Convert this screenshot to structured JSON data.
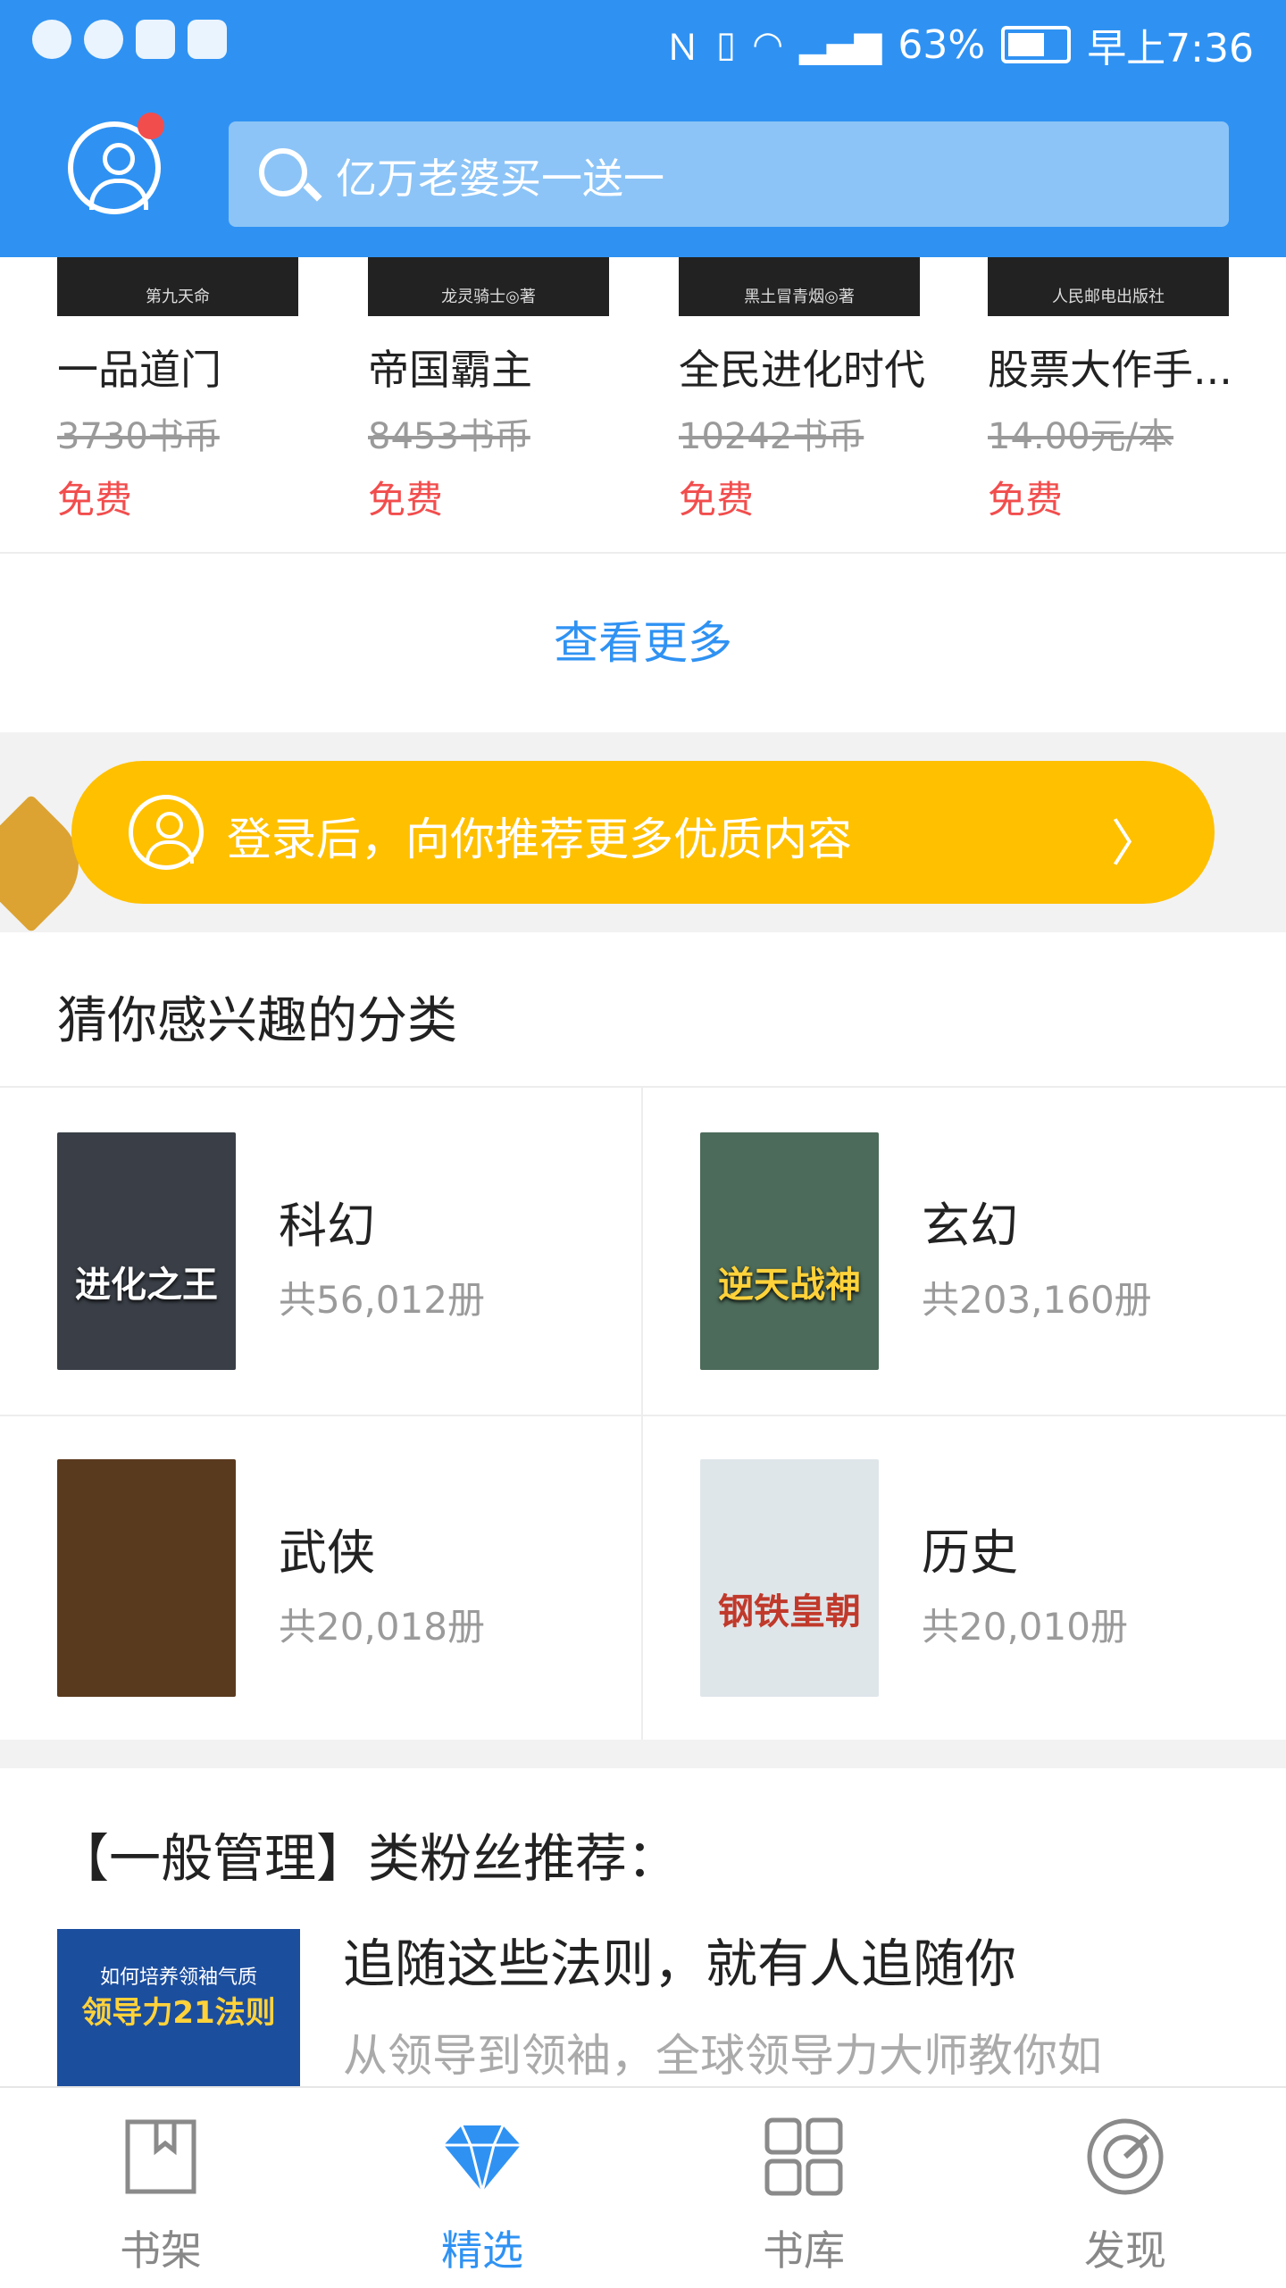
{
  "status_bar": {
    "battery": "63%",
    "time": "早上7:36"
  },
  "search": {
    "placeholder": "亿万老婆买一送一"
  },
  "top_books": [
    {
      "cover_author": "第九天命",
      "title": "一品道门",
      "original_price": "3730书币",
      "price": "免费"
    },
    {
      "cover_author": "龙灵骑士◎著",
      "title": "帝国霸主",
      "original_price": "8453书币",
      "price": "免费"
    },
    {
      "cover_author": "黑土冒青烟◎著",
      "title": "全民进化时代",
      "original_price": "10242书币",
      "price": "免费"
    },
    {
      "cover_author": "人民邮电出版社",
      "title": "股票大作手...",
      "original_price": "14.00元/本",
      "price": "免费"
    }
  ],
  "see_more": "查看更多",
  "login_banner": {
    "text": "登录后，向你推荐更多优质内容",
    "chevron": "〉"
  },
  "categories_section": {
    "title": "猜你感兴趣的分类",
    "items": [
      {
        "name": "科幻",
        "count": "共56,012册",
        "cover_text": "进化之王",
        "cover_color": "#3a3f47"
      },
      {
        "name": "玄幻",
        "count": "共203,160册",
        "cover_text": "逆天战神",
        "cover_color": "#4c6b5a"
      },
      {
        "name": "武侠",
        "count": "共20,018册",
        "cover_text": "",
        "cover_color": "#5a3a1e"
      },
      {
        "name": "历史",
        "count": "共20,010册",
        "cover_text": "钢铁皇朝",
        "cover_color": "#c0392b"
      }
    ]
  },
  "recommendation": {
    "title": "【一般管理】类粉丝推荐：",
    "book_title": "追随这些法则，就有人追随你",
    "book_desc": "从领导到领袖，全球领导力大师教你如",
    "cover_line1": "如何培养领袖气质",
    "cover_line2": "领导力21法则"
  },
  "bottom_nav": [
    {
      "label": "书架",
      "icon": "bookmark-book-icon",
      "active": false
    },
    {
      "label": "精选",
      "icon": "diamond-icon",
      "active": true
    },
    {
      "label": "书库",
      "icon": "grid-icon",
      "active": false
    },
    {
      "label": "发现",
      "icon": "compass-icon",
      "active": false
    }
  ],
  "colors": {
    "primary": "#2f92f3",
    "login_banner": "#ffc000",
    "free_red": "#f24d4d",
    "badge_red": "#f24d4d"
  }
}
